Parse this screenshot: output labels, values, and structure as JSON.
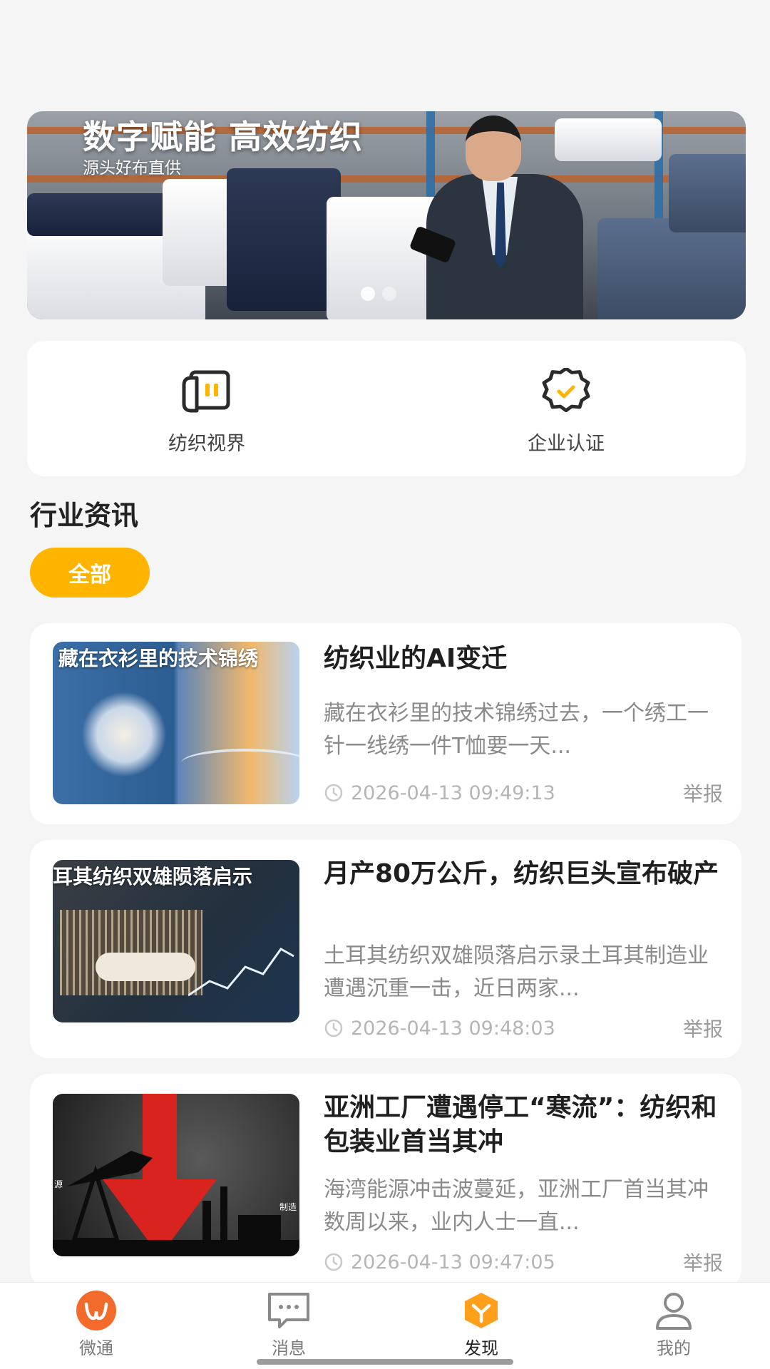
{
  "banner": {
    "title": "数字赋能 高效纺织",
    "subtitle": "源头好布直供",
    "slide_count": 2,
    "active_slide": 1
  },
  "quick_entries": [
    {
      "label": "纺织视界",
      "icon": "textile-view-icon"
    },
    {
      "label": "企业认证",
      "icon": "verified-badge-icon"
    }
  ],
  "section": {
    "title": "行业资讯",
    "filter_chip": "全部"
  },
  "news": [
    {
      "thumb_caption": "藏在衣衫里的技术锦绣",
      "title": "纺织业的AI变迁",
      "summary": "藏在衣衫里的技术锦绣过去，一个绣工一针一线绣一件T恤要一天...",
      "time": "2026-04-13 09:49:13",
      "report": "举报"
    },
    {
      "thumb_caption": "耳其纺织双雄陨落启示",
      "title": "月产80万公斤，纺织巨头宣布破产",
      "summary": "土耳其纺织双雄陨落启示录土耳其制造业遭遇沉重一击，近日两家...",
      "time": "2026-04-13 09:48:03",
      "report": "举报"
    },
    {
      "thumb_left_text": "源",
      "thumb_right_text": "制造",
      "title": "亚洲工厂遭遇停工“寒流”：纺织和包装业首当其冲",
      "summary": "海湾能源冲击波蔓延，亚洲工厂首当其冲数周以来，业内人士一直...",
      "time": "2026-04-13 09:47:05",
      "report": "举报"
    }
  ],
  "tabbar": {
    "items": [
      {
        "label": "微通",
        "icon": "app-logo-icon"
      },
      {
        "label": "消息",
        "icon": "message-icon"
      },
      {
        "label": "发现",
        "icon": "discover-icon",
        "active": true
      },
      {
        "label": "我的",
        "icon": "profile-icon"
      }
    ]
  },
  "colors": {
    "accent": "#ffb400",
    "discover_active": "#ff9f1a",
    "logo_orange": "#f36b2b"
  }
}
